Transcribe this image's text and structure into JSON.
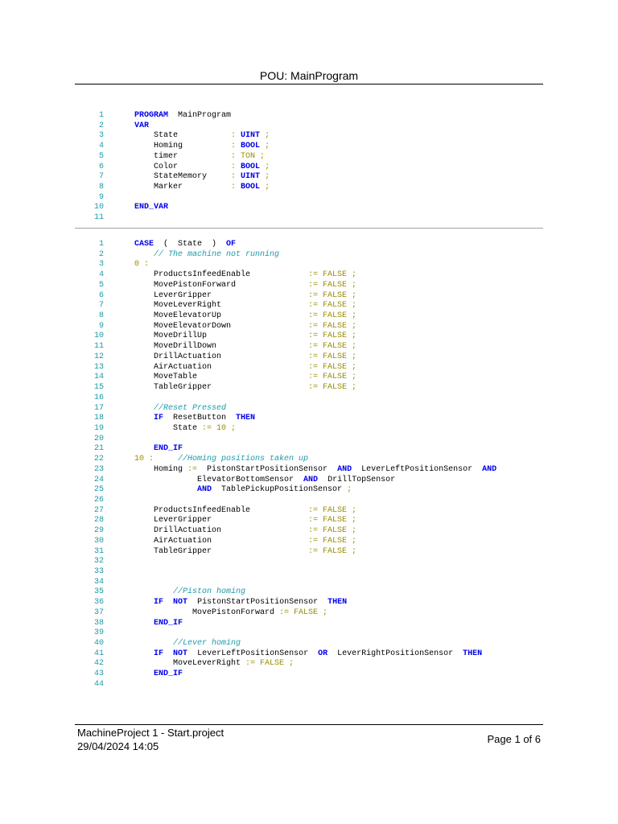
{
  "header": {
    "title": "POU: MainProgram"
  },
  "colors": {
    "keyword": "#0000ee",
    "literal": "#9a8b00",
    "comment": "#1a9aa8",
    "line_number": "#1a9aa8"
  },
  "declarations": [
    {
      "n": "1",
      "t": [
        [
          "k",
          "PROGRAM"
        ],
        [
          "p",
          "  MainProgram"
        ]
      ]
    },
    {
      "n": "2",
      "t": [
        [
          "k",
          "VAR"
        ]
      ]
    },
    {
      "n": "3",
      "t": [
        [
          "p",
          "    State           "
        ],
        [
          "y",
          ": "
        ],
        [
          "k",
          "UINT"
        ],
        [
          "y",
          " ;"
        ]
      ]
    },
    {
      "n": "4",
      "t": [
        [
          "p",
          "    Homing          "
        ],
        [
          "y",
          ": "
        ],
        [
          "k",
          "BOOL"
        ],
        [
          "y",
          " ;"
        ]
      ]
    },
    {
      "n": "5",
      "t": [
        [
          "p",
          "    timer           "
        ],
        [
          "y",
          ": TON ;"
        ]
      ]
    },
    {
      "n": "6",
      "t": [
        [
          "p",
          "    Color           "
        ],
        [
          "y",
          ": "
        ],
        [
          "k",
          "BOOL"
        ],
        [
          "y",
          " ;"
        ]
      ]
    },
    {
      "n": "7",
      "t": [
        [
          "p",
          "    StateMemory     "
        ],
        [
          "y",
          ": "
        ],
        [
          "k",
          "UINT"
        ],
        [
          "y",
          " ;"
        ]
      ]
    },
    {
      "n": "8",
      "t": [
        [
          "p",
          "    Marker          "
        ],
        [
          "y",
          ": "
        ],
        [
          "k",
          "BOOL"
        ],
        [
          "y",
          " ;"
        ]
      ]
    },
    {
      "n": "9",
      "t": []
    },
    {
      "n": "10",
      "t": [
        [
          "k",
          "END_VAR"
        ]
      ]
    },
    {
      "n": "11",
      "t": []
    }
  ],
  "body": [
    {
      "n": "1",
      "t": [
        [
          "k",
          "CASE"
        ],
        [
          "p",
          "  (  State  )  "
        ],
        [
          "k",
          "OF"
        ]
      ]
    },
    {
      "n": "2",
      "t": [
        [
          "p",
          "    "
        ],
        [
          "m",
          "// The machine not running"
        ]
      ]
    },
    {
      "n": "3",
      "t": [
        [
          "y",
          "0 :"
        ]
      ]
    },
    {
      "n": "4",
      "t": [
        [
          "p",
          "    ProductsInfeedEnable            "
        ],
        [
          "y",
          ":= FALSE ;"
        ]
      ]
    },
    {
      "n": "5",
      "t": [
        [
          "p",
          "    MovePistonForward               "
        ],
        [
          "y",
          ":= FALSE ;"
        ]
      ]
    },
    {
      "n": "6",
      "t": [
        [
          "p",
          "    LeverGripper                    "
        ],
        [
          "y",
          ":= FALSE ;"
        ]
      ]
    },
    {
      "n": "7",
      "t": [
        [
          "p",
          "    MoveLeverRight                  "
        ],
        [
          "y",
          ":= FALSE ;"
        ]
      ]
    },
    {
      "n": "8",
      "t": [
        [
          "p",
          "    MoveElevatorUp                  "
        ],
        [
          "y",
          ":= FALSE ;"
        ]
      ]
    },
    {
      "n": "9",
      "t": [
        [
          "p",
          "    MoveElevatorDown                "
        ],
        [
          "y",
          ":= FALSE ;"
        ]
      ]
    },
    {
      "n": "10",
      "t": [
        [
          "p",
          "    MoveDrillUp                     "
        ],
        [
          "y",
          ":= FALSE ;"
        ]
      ]
    },
    {
      "n": "11",
      "t": [
        [
          "p",
          "    MoveDrillDown                   "
        ],
        [
          "y",
          ":= FALSE ;"
        ]
      ]
    },
    {
      "n": "12",
      "t": [
        [
          "p",
          "    DrillActuation                  "
        ],
        [
          "y",
          ":= FALSE ;"
        ]
      ]
    },
    {
      "n": "13",
      "t": [
        [
          "p",
          "    AirActuation                    "
        ],
        [
          "y",
          ":= FALSE ;"
        ]
      ]
    },
    {
      "n": "14",
      "t": [
        [
          "p",
          "    MoveTable                       "
        ],
        [
          "y",
          ":= FALSE ;"
        ]
      ]
    },
    {
      "n": "15",
      "t": [
        [
          "p",
          "    TableGripper                    "
        ],
        [
          "y",
          ":= FALSE ;"
        ]
      ]
    },
    {
      "n": "16",
      "t": []
    },
    {
      "n": "17",
      "t": [
        [
          "p",
          "    "
        ],
        [
          "m",
          "//Reset Pressed"
        ]
      ]
    },
    {
      "n": "18",
      "t": [
        [
          "p",
          "    "
        ],
        [
          "k",
          "IF"
        ],
        [
          "p",
          "  ResetButton  "
        ],
        [
          "k",
          "THEN"
        ]
      ]
    },
    {
      "n": "19",
      "t": [
        [
          "p",
          "        State "
        ],
        [
          "y",
          ":= 10 ;"
        ]
      ]
    },
    {
      "n": "20",
      "t": []
    },
    {
      "n": "21",
      "t": [
        [
          "p",
          "    "
        ],
        [
          "k",
          "END_IF"
        ]
      ]
    },
    {
      "n": "22",
      "t": [
        [
          "y",
          "10 :"
        ],
        [
          "p",
          "     "
        ],
        [
          "m",
          "//Homing positions taken up"
        ]
      ]
    },
    {
      "n": "23",
      "t": [
        [
          "p",
          "    Homing "
        ],
        [
          "y",
          ":="
        ],
        [
          "p",
          "  PistonStartPositionSensor  "
        ],
        [
          "k",
          "AND"
        ],
        [
          "p",
          "  LeverLeftPositionSensor  "
        ],
        [
          "k",
          "AND"
        ]
      ]
    },
    {
      "n": "24",
      "t": [
        [
          "p",
          "             ElevatorBottomSensor  "
        ],
        [
          "k",
          "AND"
        ],
        [
          "p",
          "  DrillTopSensor"
        ]
      ]
    },
    {
      "n": "25",
      "t": [
        [
          "p",
          "             "
        ],
        [
          "k",
          "AND"
        ],
        [
          "p",
          "  TablePickupPositionSensor "
        ],
        [
          "y",
          ";"
        ]
      ]
    },
    {
      "n": "26",
      "t": []
    },
    {
      "n": "27",
      "t": [
        [
          "p",
          "    ProductsInfeedEnable            "
        ],
        [
          "y",
          ":= FALSE ;"
        ]
      ]
    },
    {
      "n": "28",
      "t": [
        [
          "p",
          "    LeverGripper                    "
        ],
        [
          "y",
          ":= FALSE ;"
        ]
      ]
    },
    {
      "n": "29",
      "t": [
        [
          "p",
          "    DrillActuation                  "
        ],
        [
          "y",
          ":= FALSE ;"
        ]
      ]
    },
    {
      "n": "30",
      "t": [
        [
          "p",
          "    AirActuation                    "
        ],
        [
          "y",
          ":= FALSE ;"
        ]
      ]
    },
    {
      "n": "31",
      "t": [
        [
          "p",
          "    TableGripper                    "
        ],
        [
          "y",
          ":= FALSE ;"
        ]
      ]
    },
    {
      "n": "32",
      "t": []
    },
    {
      "n": "33",
      "t": []
    },
    {
      "n": "34",
      "t": []
    },
    {
      "n": "35",
      "t": [
        [
          "p",
          "        "
        ],
        [
          "m",
          "//Piston homing"
        ]
      ]
    },
    {
      "n": "36",
      "t": [
        [
          "p",
          "    "
        ],
        [
          "k",
          "IF"
        ],
        [
          "p",
          "  "
        ],
        [
          "k",
          "NOT"
        ],
        [
          "p",
          "  PistonStartPositionSensor  "
        ],
        [
          "k",
          "THEN"
        ]
      ]
    },
    {
      "n": "37",
      "t": [
        [
          "p",
          "            MovePistonForward "
        ],
        [
          "y",
          ":= FALSE ;"
        ]
      ]
    },
    {
      "n": "38",
      "t": [
        [
          "p",
          "    "
        ],
        [
          "k",
          "END_IF"
        ]
      ]
    },
    {
      "n": "39",
      "t": []
    },
    {
      "n": "40",
      "t": [
        [
          "p",
          "        "
        ],
        [
          "m",
          "//Lever homing"
        ]
      ]
    },
    {
      "n": "41",
      "t": [
        [
          "p",
          "    "
        ],
        [
          "k",
          "IF"
        ],
        [
          "p",
          "  "
        ],
        [
          "k",
          "NOT"
        ],
        [
          "p",
          "  LeverLeftPositionSensor  "
        ],
        [
          "k",
          "OR"
        ],
        [
          "p",
          "  LeverRightPositionSensor  "
        ],
        [
          "k",
          "THEN"
        ]
      ]
    },
    {
      "n": "42",
      "t": [
        [
          "p",
          "        MoveLeverRight "
        ],
        [
          "y",
          ":= FALSE ;"
        ]
      ]
    },
    {
      "n": "43",
      "t": [
        [
          "p",
          "    "
        ],
        [
          "k",
          "END_IF"
        ]
      ]
    },
    {
      "n": "44",
      "t": []
    }
  ],
  "footer": {
    "project": "MachineProject 1 - Start.project",
    "datetime": "29/04/2024 14:05",
    "page": "Page 1 of 6"
  }
}
